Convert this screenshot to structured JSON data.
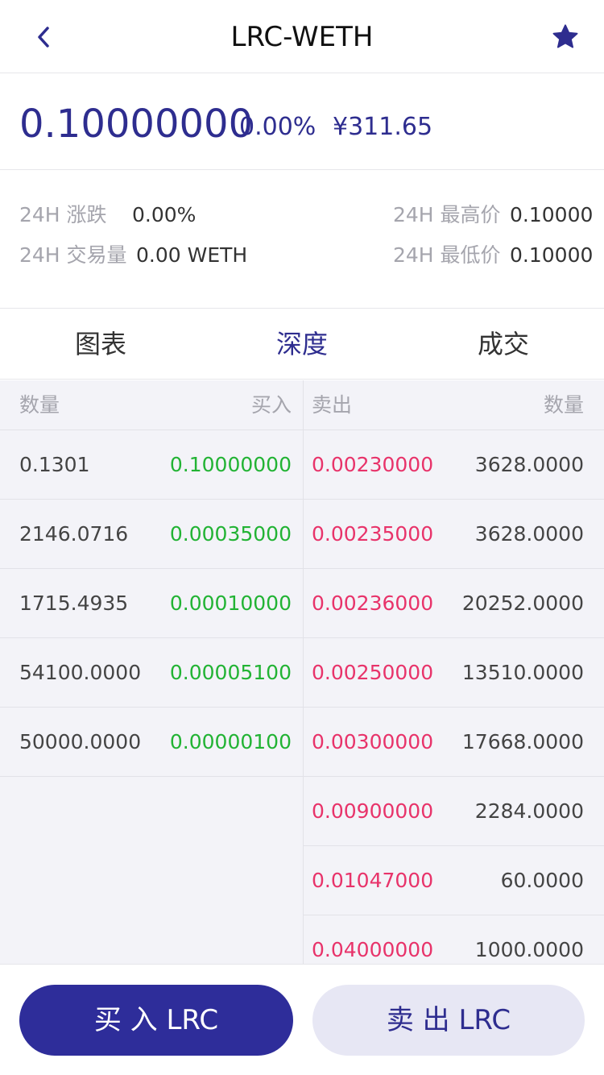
{
  "header": {
    "title": "LRC-WETH",
    "back_icon": "chevron-left-icon",
    "favorite_icon": "star-icon",
    "accent": "#2e2d8f"
  },
  "price": {
    "last": "0.10000000",
    "change": "0.00%",
    "cny": "¥311.65"
  },
  "stats": {
    "change_label": "24H 涨跌",
    "change_value": "0.00%",
    "volume_label": "24H 交易量",
    "volume_value": "0.00 WETH",
    "high_label": "24H 最高价",
    "high_value": "0.10000",
    "low_label": "24H 最低价",
    "low_value": "0.10000"
  },
  "tabs": [
    {
      "label": "图表",
      "active": false
    },
    {
      "label": "深度",
      "active": true
    },
    {
      "label": "成交",
      "active": false
    }
  ],
  "orderbook": {
    "bids_header": {
      "amount": "数量",
      "price": "买入"
    },
    "asks_header": {
      "price": "卖出",
      "amount": "数量"
    },
    "bids": [
      {
        "amount": "0.1301",
        "price": "0.10000000"
      },
      {
        "amount": "2146.0716",
        "price": "0.00035000"
      },
      {
        "amount": "1715.4935",
        "price": "0.00010000"
      },
      {
        "amount": "54100.0000",
        "price": "0.00005100"
      },
      {
        "amount": "50000.0000",
        "price": "0.00000100"
      }
    ],
    "asks": [
      {
        "price": "0.00230000",
        "amount": "3628.0000"
      },
      {
        "price": "0.00235000",
        "amount": "3628.0000"
      },
      {
        "price": "0.00236000",
        "amount": "20252.0000"
      },
      {
        "price": "0.00250000",
        "amount": "13510.0000"
      },
      {
        "price": "0.00300000",
        "amount": "17668.0000"
      },
      {
        "price": "0.00900000",
        "amount": "2284.0000"
      },
      {
        "price": "0.01047000",
        "amount": "60.0000"
      },
      {
        "price": "0.04000000",
        "amount": "1000.0000"
      }
    ],
    "colors": {
      "buy": "#22b334",
      "sell": "#e8336a"
    }
  },
  "actions": {
    "buy_label": "买 入 LRC",
    "sell_label": "卖 出 LRC"
  }
}
